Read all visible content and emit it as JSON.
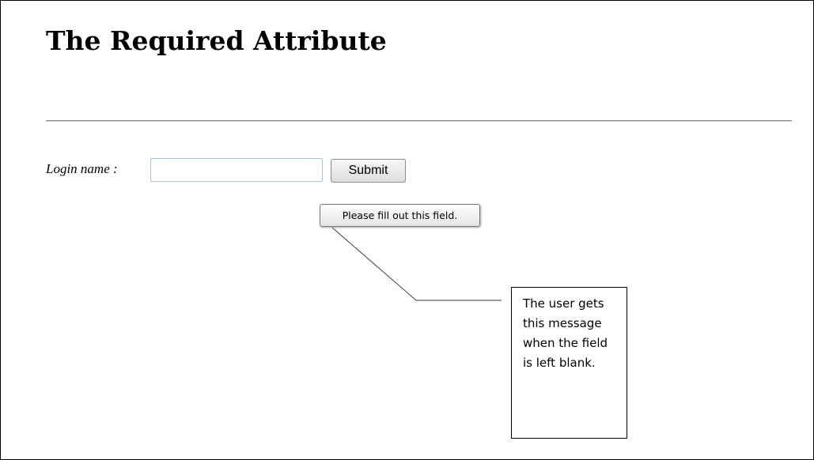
{
  "page": {
    "title": "The Required Attribute"
  },
  "form": {
    "login_label": "Login name :",
    "login_value": "",
    "submit_label": "Submit"
  },
  "validation": {
    "message": "Please fill out this field."
  },
  "annotation": {
    "text": "The user gets this message when the field is left blank."
  }
}
